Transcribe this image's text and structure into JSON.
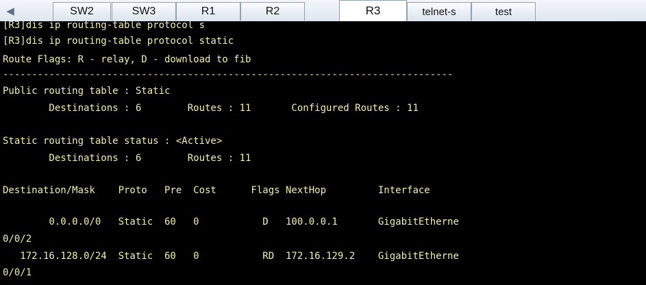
{
  "tabs": [
    {
      "label": "SW2"
    },
    {
      "label": "SW3"
    },
    {
      "label": "R1"
    },
    {
      "label": "R2"
    },
    {
      "label": "R3"
    },
    {
      "label": "telnet-s"
    },
    {
      "label": "test"
    }
  ],
  "active_tab": "R3",
  "terminal": {
    "lines": [
      "[R3]dis ip routing-table protocol s",
      "[R3]dis ip routing-table protocol static",
      "Route Flags: R - relay, D - download to fib",
      "------------------------------------------------------------------------------",
      "Public routing table : Static",
      "        Destinations : 6        Routes : 11       Configured Routes : 11",
      "Static routing table status : <Active>",
      "        Destinations : 6        Routes : 11",
      "Destination/Mask    Proto   Pre  Cost      Flags NextHop         Interface",
      "        0.0.0.0/0   Static  60   0           D   100.0.0.1       GigabitEtherne",
      "0/0/2",
      "   172.16.128.0/24  Static  60   0           RD  172.16.129.2    GigabitEtherne",
      "0/0/1"
    ]
  }
}
